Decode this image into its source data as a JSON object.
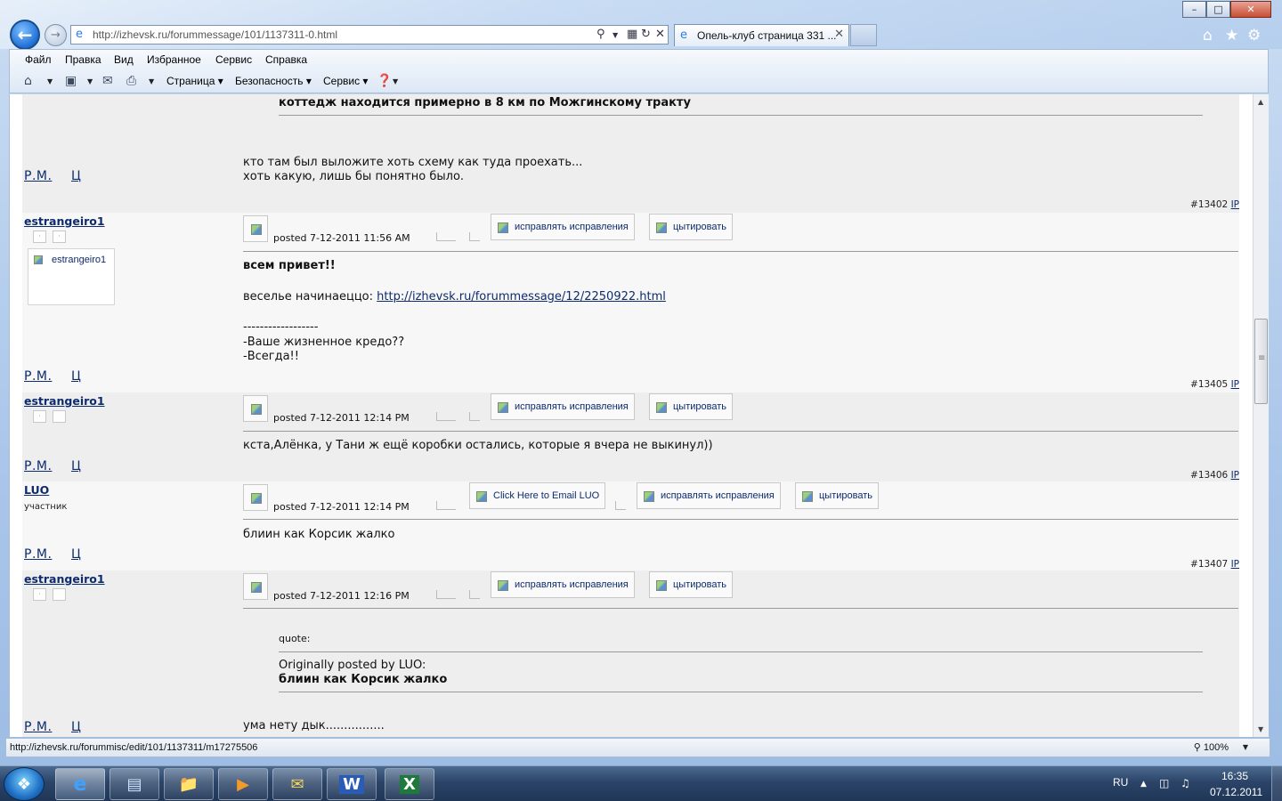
{
  "browser": {
    "address_url": "http://izhevsk.ru/forummessage/101/1137311-0.html",
    "tab_title": "Опель-клуб страница 331 ...",
    "menu": [
      "Файл",
      "Правка",
      "Вид",
      "Избранное",
      "Сервис",
      "Справка"
    ],
    "commands": {
      "page": "Страница",
      "safety": "Безопасность",
      "tools": "Сервис"
    }
  },
  "forum": {
    "top_post": {
      "quote_tail": "коттедж находится примерно в 8 км по Можгинскому тракту",
      "body_line1": "кто там был выложите хоть схему как туда проехать...",
      "body_line2": "хоть какую, лишь бы понятно было.",
      "rm": "Р.М.",
      "ts": "Ц"
    },
    "posts": [
      {
        "number": "#13402",
        "ip": "IP",
        "nick": "estrangeiro1",
        "avatar_label": "estrangeiro1",
        "posted": "posted 7-12-2011 11:56 AM",
        "btn_edit": "исправлять исправления",
        "btn_quote": "цытировать",
        "title": "всем привет!!",
        "line_link_prefix": "веселье начинаеццо: ",
        "link": "http://izhevsk.ru/forummessage/12/2250922.html",
        "sig_sep": "------------------",
        "sig1": "-Ваше жизненное кредо??",
        "sig2": "-Всегда!!",
        "rm": "Р.М.",
        "ts": "Ц"
      },
      {
        "number": "#13405",
        "ip": "IP",
        "nick": "estrangeiro1",
        "posted": "posted 7-12-2011 12:14 PM",
        "btn_edit": "исправлять исправления",
        "btn_quote": "цытировать",
        "body": "кста,Алёнка, у Тани ж ещё коробки остались, которые я вчера не выкинул))",
        "rm": "Р.М.",
        "ts": "Ц"
      },
      {
        "number": "#13406",
        "ip": "IP",
        "nick": "LUO",
        "rank": "участник",
        "posted": "posted 7-12-2011 12:14 PM",
        "btn_email": "Click Here to Email LUO",
        "btn_edit": "исправлять исправления",
        "btn_quote": "цытировать",
        "body": "блиин как Корсик жалко",
        "rm": "Р.М.",
        "ts": "Ц"
      },
      {
        "number": "#13407",
        "ip": "IP",
        "nick": "estrangeiro1",
        "posted": "posted 7-12-2011 12:16 PM",
        "btn_edit": "исправлять исправления",
        "btn_quote": "цытировать",
        "quote_label": "quote:",
        "quote_author": "Originally posted by LUO:",
        "quote_text": "блиин как Корсик жалко",
        "body": "ума нету дык................",
        "rm": "Р.М.",
        "ts": "Ц"
      }
    ]
  },
  "status": {
    "url": "http://izhevsk.ru/forummisc/edit/101/1137311/m17275506",
    "zoom": "100%"
  },
  "taskbar": {
    "lang": "RU",
    "time": "16:35",
    "date": "07.12.2011"
  }
}
